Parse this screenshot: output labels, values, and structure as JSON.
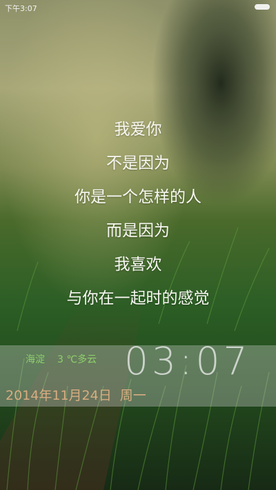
{
  "status_bar": {
    "time": "下午3:07"
  },
  "poem": {
    "lines": [
      "我爱你",
      "不是因为",
      "你是一个怎样的人",
      "而是因为",
      "我喜欢",
      "与你在一起时的感觉"
    ]
  },
  "weather": {
    "location": "海淀",
    "temperature": "3 ℃",
    "condition": "多云"
  },
  "clock": {
    "time": "03:07"
  },
  "date": {
    "date": "2014年11月24日",
    "weekday": "周一"
  },
  "colors": {
    "weather": "#8ed06b",
    "date": "#d8ad80",
    "clock": "#f0f0f0"
  },
  "background": {
    "description_icon": "grass-field-wallpaper"
  }
}
